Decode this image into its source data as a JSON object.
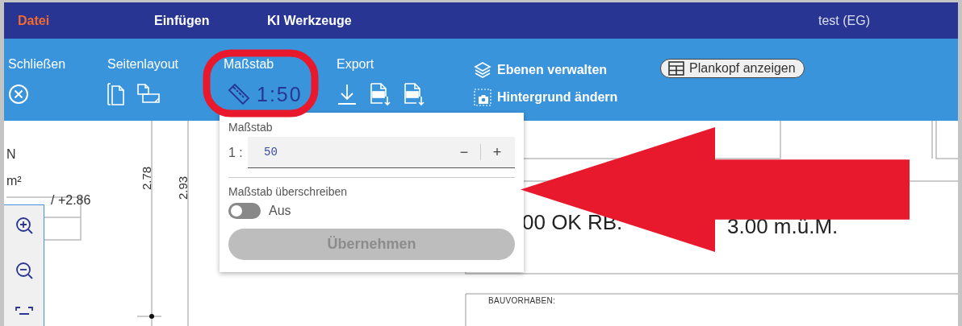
{
  "menu_bar": {
    "items": [
      {
        "label": "Datei",
        "selected": true
      },
      {
        "label": "Einfügen",
        "selected": false
      },
      {
        "label": "KI Werkzeuge",
        "selected": false
      }
    ],
    "project": "test (EG)"
  },
  "ribbon": {
    "groups": [
      {
        "kind": "close",
        "label": "Schließen"
      },
      {
        "kind": "layout",
        "label": "Seitenlayout"
      },
      {
        "kind": "scale",
        "label": "Maßstab",
        "value": "1:50"
      },
      {
        "kind": "export",
        "label": "Export"
      }
    ],
    "actions": [
      {
        "kind": "layers",
        "label": "Ebenen verwalten"
      },
      {
        "kind": "background",
        "label": "Hintergrund ändern"
      }
    ],
    "plankopf_button": {
      "label": "Plankopf anzeigen"
    }
  },
  "scale_popup": {
    "title": "Maßstab",
    "prefix": "1 :",
    "value": "50",
    "decrement": "−",
    "increment": "+",
    "override_label": "Maßstab überschreiben",
    "override": {
      "on": false,
      "state_label": "Aus"
    },
    "apply": {
      "label": "Übernehmen",
      "disabled": true
    }
  },
  "plan": {
    "texts": [
      {
        "text": "N",
        "kind": "label"
      },
      {
        "text": "m²",
        "kind": "label"
      },
      {
        "text": "/ +2.86",
        "kind": "label"
      },
      {
        "text": "2.78",
        "kind": "vertical"
      },
      {
        "text": "2.93",
        "kind": "vertical"
      },
      {
        "text": "00 OK RB.",
        "kind": "large"
      },
      {
        "text": "3.00 m.ü.M.",
        "kind": "large"
      },
      {
        "text": "BAUVORHABEN:",
        "kind": "small"
      }
    ]
  },
  "zoom_tools": [
    {
      "kind": "zoom-in"
    },
    {
      "kind": "zoom-out"
    },
    {
      "kind": "fit"
    }
  ],
  "annotations": [
    {
      "kind": "ellipse"
    },
    {
      "kind": "arrow"
    }
  ]
}
